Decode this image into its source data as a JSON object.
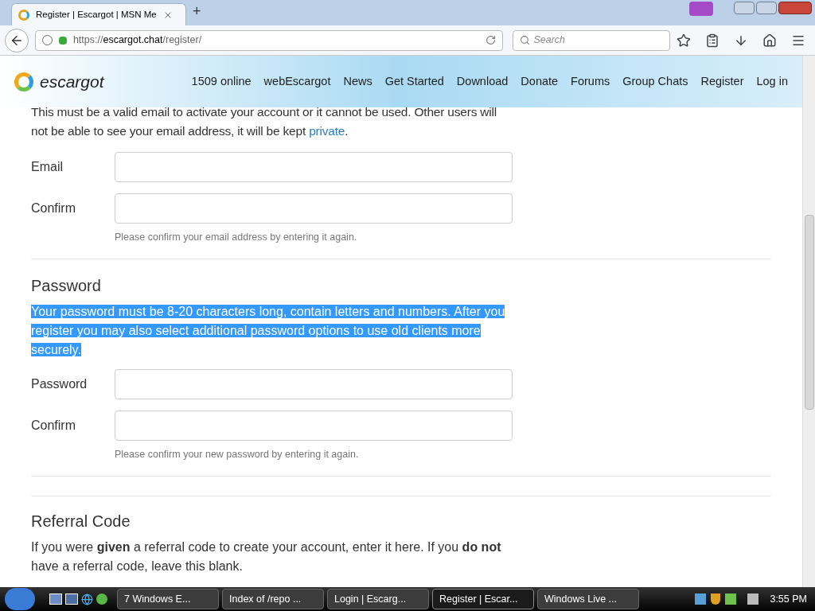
{
  "browser": {
    "tab_title": "Register | Escargot | MSN Me",
    "new_tab": "+",
    "url_scheme": "https://",
    "url_host": "escargot.chat",
    "url_path": "/register/",
    "search_placeholder": "Search"
  },
  "site": {
    "logo": "escargot",
    "nav": [
      {
        "label": "1509 online"
      },
      {
        "label": "webEscargot"
      },
      {
        "label": "News"
      },
      {
        "label": "Get Started"
      },
      {
        "label": "Download"
      },
      {
        "label": "Donate"
      },
      {
        "label": "Forums"
      },
      {
        "label": "Group Chats"
      },
      {
        "label": "Register"
      },
      {
        "label": "Log in"
      }
    ]
  },
  "email_section": {
    "intro": "This must be a valid email to activate your account or it cannot be used. Other users will not be able to see your email address, it will be kept",
    "link": "private",
    "end": ".",
    "fields": [
      {
        "label": "Email"
      },
      {
        "label": "Confirm",
        "help": "Please confirm your email address by entering it again."
      }
    ]
  },
  "password_section": {
    "heading": "Password",
    "intro": "Your password must be 8-20 characters long, contain letters and numbers. After you register you may also select additional password options to use old clients more securely.",
    "selected": true,
    "fields": [
      {
        "label": "Password"
      },
      {
        "label": "Confirm",
        "help": "Please confirm your new password by entering it again."
      }
    ]
  },
  "referral_section": {
    "heading": "Referral Code",
    "intro": "If you were **given** a referral code to create your account, enter it here. If you **do not** have a referral code, leave this blank."
  },
  "taskbar": {
    "tasks": [
      {
        "label": "7 Windows E...",
        "selected": false
      },
      {
        "label": "Index of /repo ...",
        "selected": false
      },
      {
        "label": "Login | Escarg...",
        "selected": false
      },
      {
        "label": "Register | Escar...",
        "selected": true
      },
      {
        "label": "Windows Live ...",
        "selected": false
      }
    ],
    "clock": "3:55 PM"
  }
}
